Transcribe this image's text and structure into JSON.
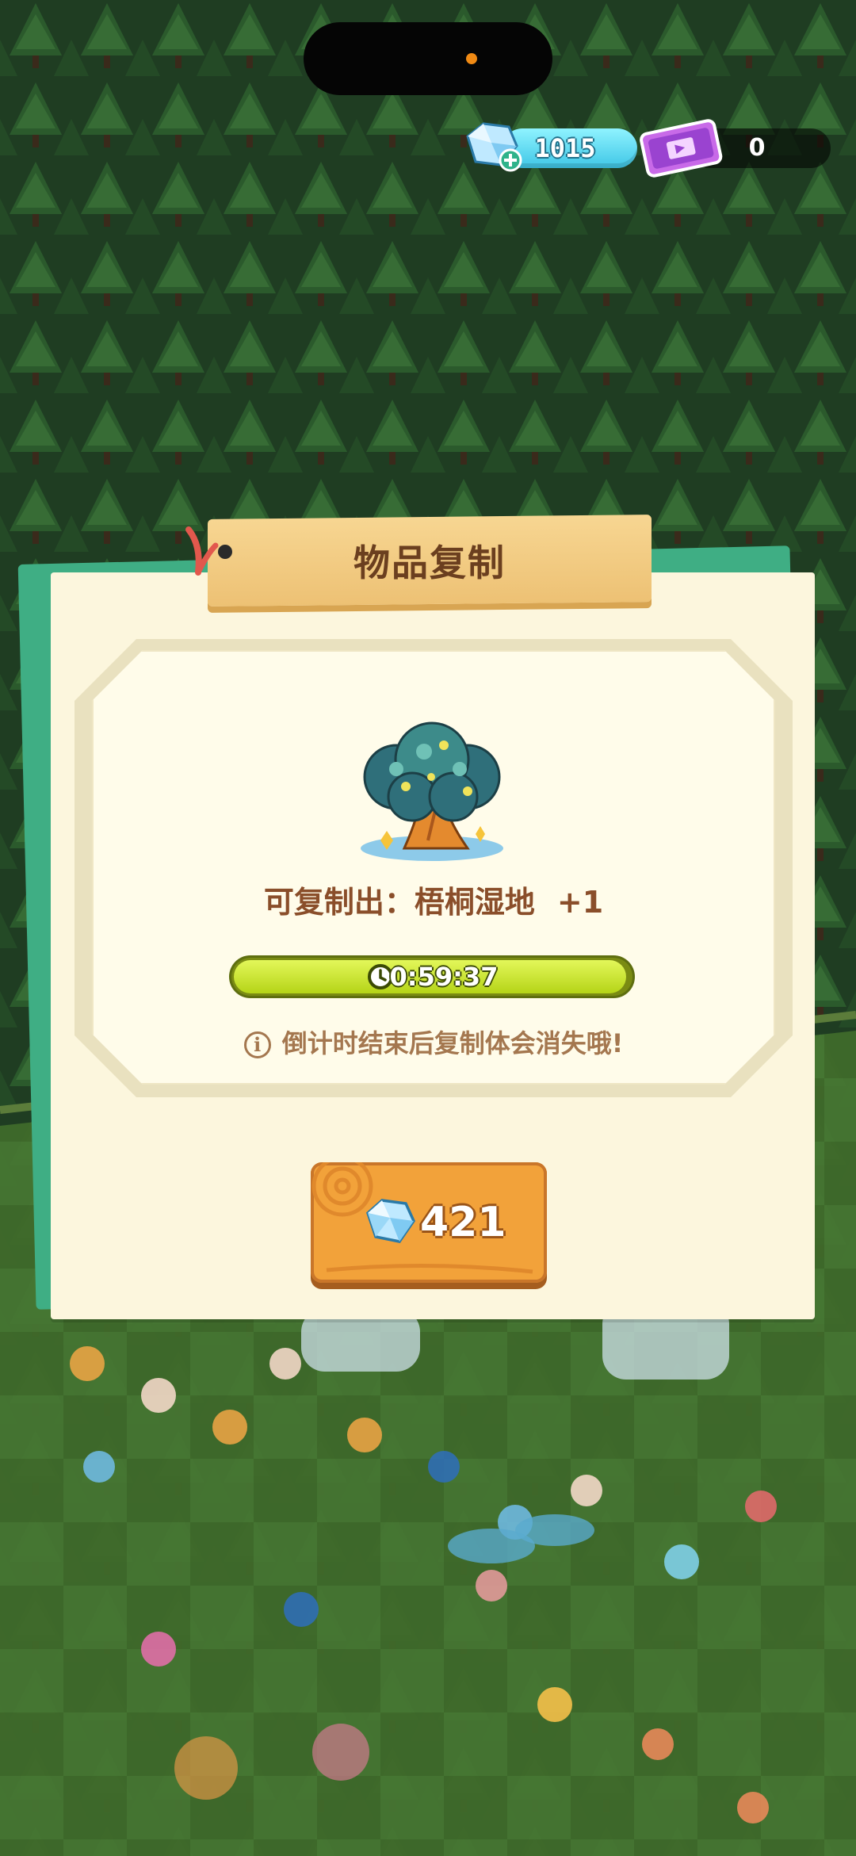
{
  "status": {
    "gems": "1015",
    "tickets": "0"
  },
  "dialog": {
    "title": "物品复制",
    "copy_prefix": "可复制出：",
    "item_name": "梧桐湿地",
    "copy_amount": "+1",
    "countdown": "0:59:37",
    "countdown_progress": 0.99,
    "notice": "倒计时结束后复制体会消失哦!",
    "price": "421"
  },
  "icons": {
    "gem": "gem-icon",
    "ticket": "ticket-icon",
    "clock": "clock-icon",
    "info": "info-icon",
    "item": "parasol-tree-icon"
  },
  "colors": {
    "panel": "#fcf6dd",
    "title_tab": "#edc174",
    "title_text": "#6b3f1f",
    "accent_green": "#3fae84",
    "progress_fill": "#c4e02a",
    "button": "#f2a23a"
  }
}
